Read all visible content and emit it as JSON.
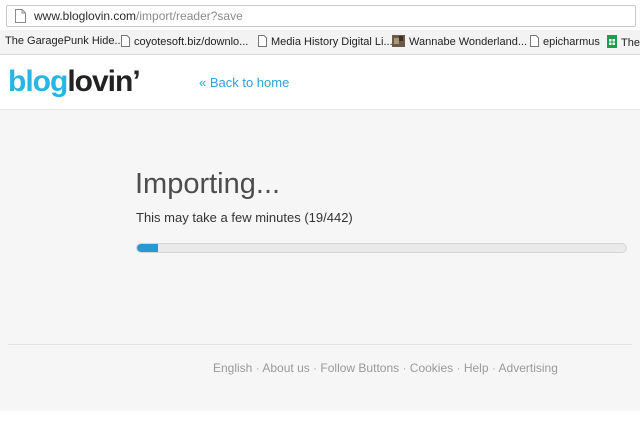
{
  "browser": {
    "url_host": "www.bloglovin.com",
    "url_path": "/import/reader?save"
  },
  "bookmarks": [
    {
      "label": "The GaragePunk Hide...",
      "icon": "favicon-icon"
    },
    {
      "label": "coyotesoft.biz/downlo...",
      "icon": "page-icon"
    },
    {
      "label": "Media History Digital Li...",
      "icon": "page-icon"
    },
    {
      "label": "Wannabe Wonderland...",
      "icon": "image-favicon-icon"
    },
    {
      "label": "epicharmus",
      "icon": "page-icon"
    },
    {
      "label": "The",
      "icon": "sheets-icon"
    }
  ],
  "header": {
    "logo_part1": "blog",
    "logo_part2": "lovin’",
    "back_link": "« Back to home"
  },
  "main": {
    "title": "Importing...",
    "subtitle": "This may take a few minutes (19/442)",
    "progress_fraction": 0.043
  },
  "footer": {
    "links": [
      "English",
      "About us",
      "Follow Buttons",
      "Cookies",
      "Help",
      "Advertising"
    ],
    "separator": " · "
  },
  "colors": {
    "brand_blue": "#2ab4e6",
    "progress_fill": "#2a96d4",
    "link": "#2ea2d8"
  }
}
